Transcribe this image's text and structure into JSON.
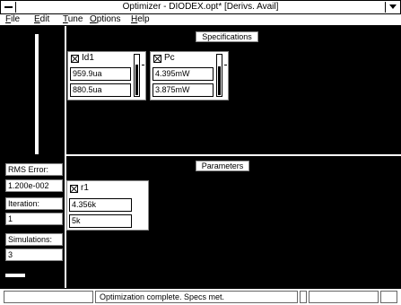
{
  "window": {
    "title": "Optimizer - DIODEX.opt* [Derivs. Avail]"
  },
  "menu": {
    "items": [
      "File",
      "Edit",
      "Tune",
      "Options",
      "Help"
    ]
  },
  "left_panel": {
    "rms_label": "RMS Error:",
    "rms_value": "1.200e-002",
    "iteration_label": "Iteration:",
    "iteration_value": "1",
    "simulations_label": "Simulations:",
    "simulations_value": "3"
  },
  "specifications": {
    "header": "Specifications",
    "cards": [
      {
        "name": "Id1",
        "checked": true,
        "value1": "959.9ua",
        "value2": "880.5ua",
        "level": 0.78
      },
      {
        "name": "Pc",
        "checked": true,
        "value1": "4.395mW",
        "value2": "3.875mW",
        "level": 0.72
      }
    ]
  },
  "parameters": {
    "header": "Parameters",
    "cards": [
      {
        "name": "r1",
        "checked": true,
        "value1": "4.356k",
        "value2": "5k"
      }
    ]
  },
  "status": {
    "message": "Optimization complete.  Specs met."
  }
}
